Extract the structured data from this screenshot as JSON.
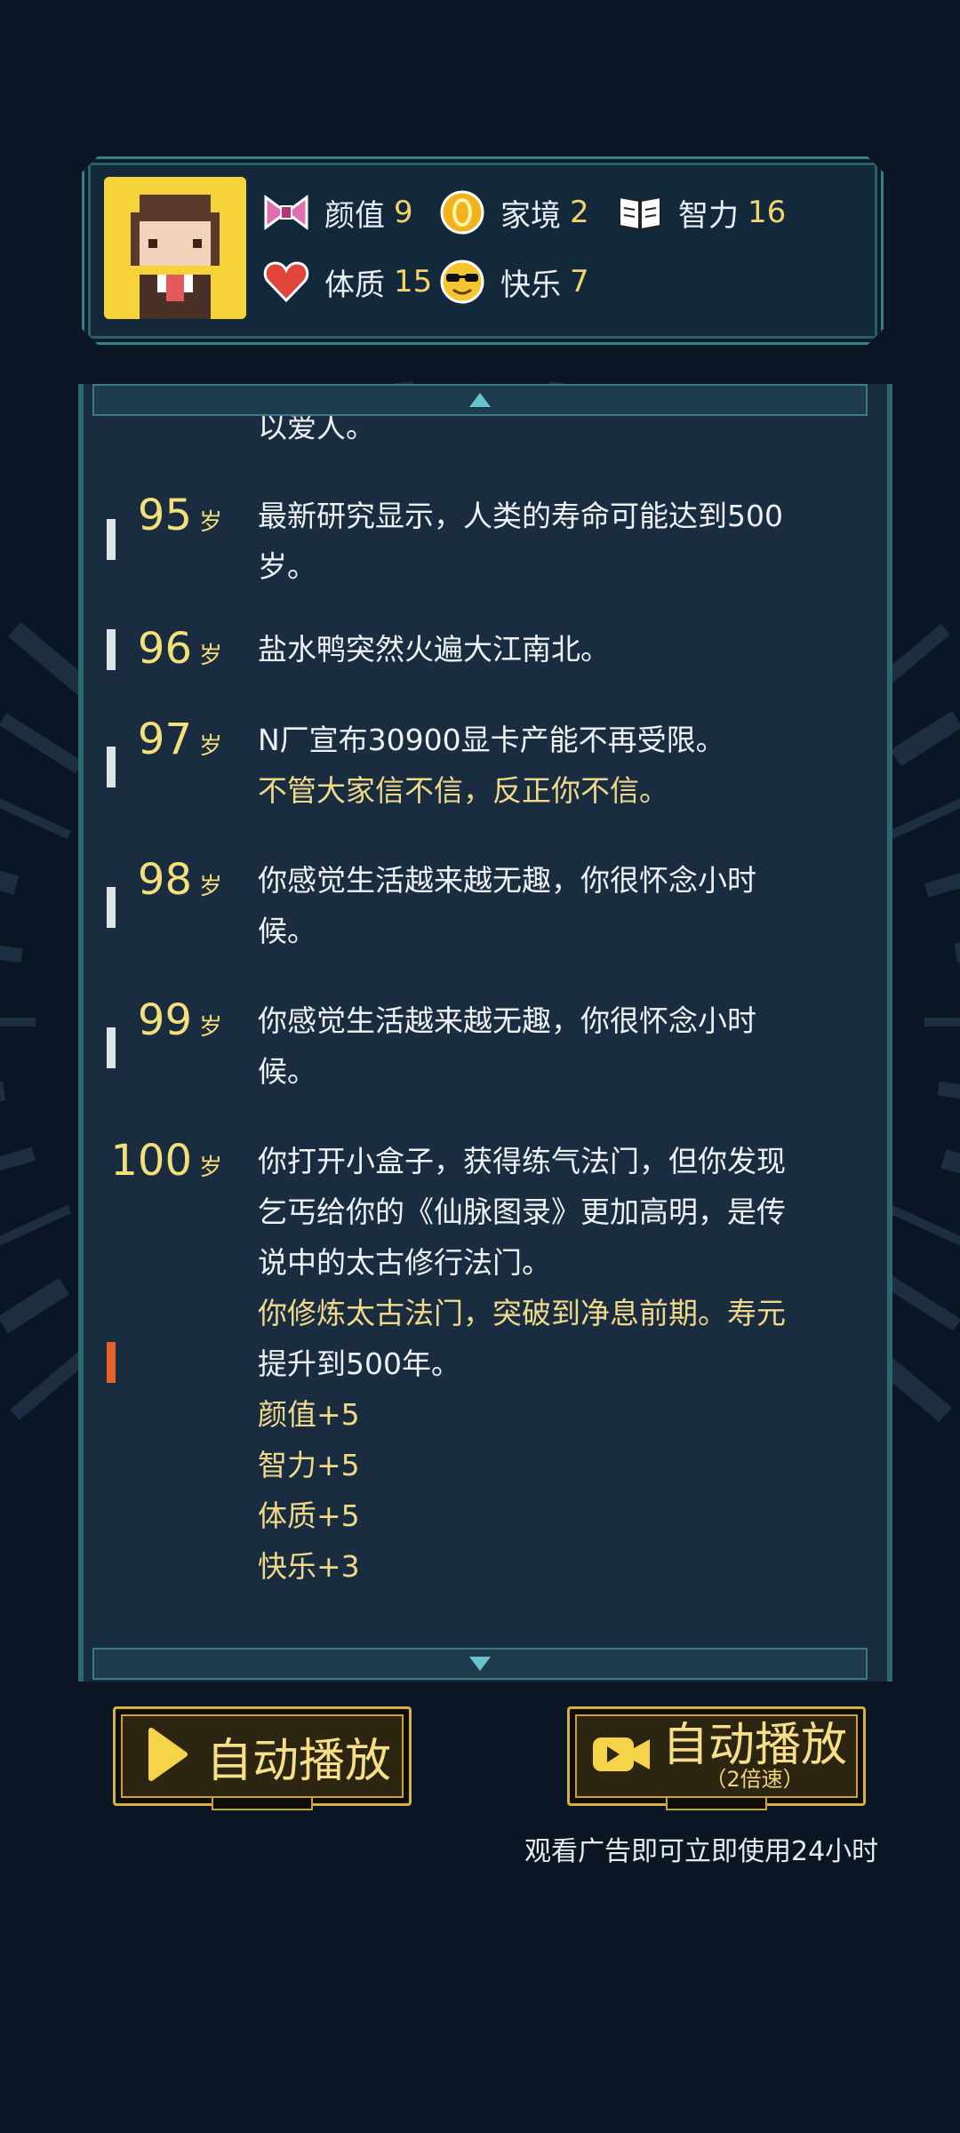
{
  "stats": {
    "appearance": {
      "label": "颜值",
      "value": "9",
      "icon": "bow-icon"
    },
    "family": {
      "label": "家境",
      "value": "2",
      "icon": "coin-icon"
    },
    "intelligence": {
      "label": "智力",
      "value": "16",
      "icon": "book-icon"
    },
    "physique": {
      "label": "体质",
      "value": "15",
      "icon": "heart-icon"
    },
    "happiness": {
      "label": "快乐",
      "value": "7",
      "icon": "sunglasses-icon"
    }
  },
  "log": {
    "cut_off_text": "以爱人。",
    "entries": [
      {
        "age": "95",
        "unit": "岁",
        "lines": [
          "最新研究显示，人类的寿命可能达到500",
          "岁。"
        ]
      },
      {
        "age": "96",
        "unit": "岁",
        "lines": [
          "盐水鸭突然火遍大江南北。"
        ]
      },
      {
        "age": "97",
        "unit": "岁",
        "lines": [
          "N厂宣布30900显卡产能不再受限。"
        ],
        "gold_lines": [
          "不管大家信不信，反正你不信。"
        ]
      },
      {
        "age": "98",
        "unit": "岁",
        "lines": [
          "你感觉生活越来越无趣，你很怀念小时",
          "候。"
        ]
      },
      {
        "age": "99",
        "unit": "岁",
        "lines": [
          "你感觉生活越来越无趣，你很怀念小时",
          "候。"
        ]
      },
      {
        "age": "100",
        "unit": "岁",
        "lines": [
          "你打开小盒子，获得练气法门，但你发现",
          "乞丐给你的《仙脉图录》更加高明，是传",
          "说中的太古修行法门。"
        ],
        "gold_lines": [
          "你修炼太古法门，突破到净息前期。寿元",
          "提升到500年。"
        ],
        "bonus_lines": [
          "颜值+5",
          "智力+5",
          "体质+5",
          "快乐+3"
        ]
      }
    ]
  },
  "buttons": {
    "autoplay": {
      "label": "自动播放",
      "icon": "play-icon"
    },
    "autoplay_ad": {
      "label": "自动播放",
      "sub": "（2倍速）",
      "icon": "video-camera-icon"
    }
  },
  "ad_note": "观看广告即可立即使用24小时",
  "colors": {
    "accent_gold": "#f3e07a",
    "panel": "#1a2c3f",
    "border_teal": "#3a7d86",
    "marker_orange": "#e5612b"
  }
}
